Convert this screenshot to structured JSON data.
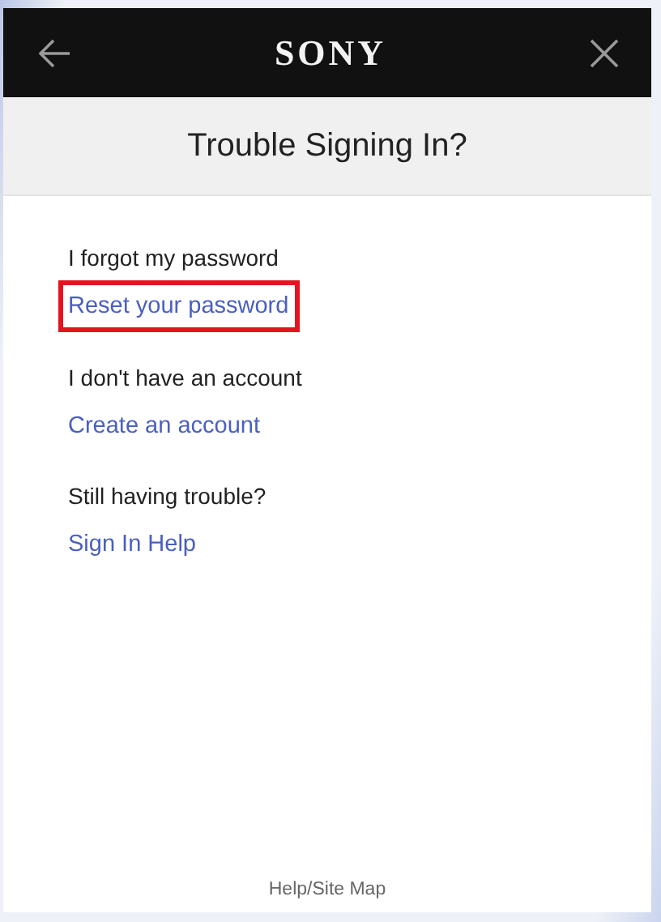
{
  "header": {
    "logo": "SONY"
  },
  "title": "Trouble Signing In?",
  "sections": [
    {
      "label": "I forgot my password",
      "link": {
        "text": "Reset your password",
        "highlighted": true
      }
    },
    {
      "label": "I don't have an account",
      "link": {
        "text": "Create an account",
        "highlighted": false
      }
    },
    {
      "label": "Still having trouble?",
      "link": {
        "text": "Sign In Help",
        "highlighted": false
      }
    }
  ],
  "footer_link": "Help/Site Map"
}
